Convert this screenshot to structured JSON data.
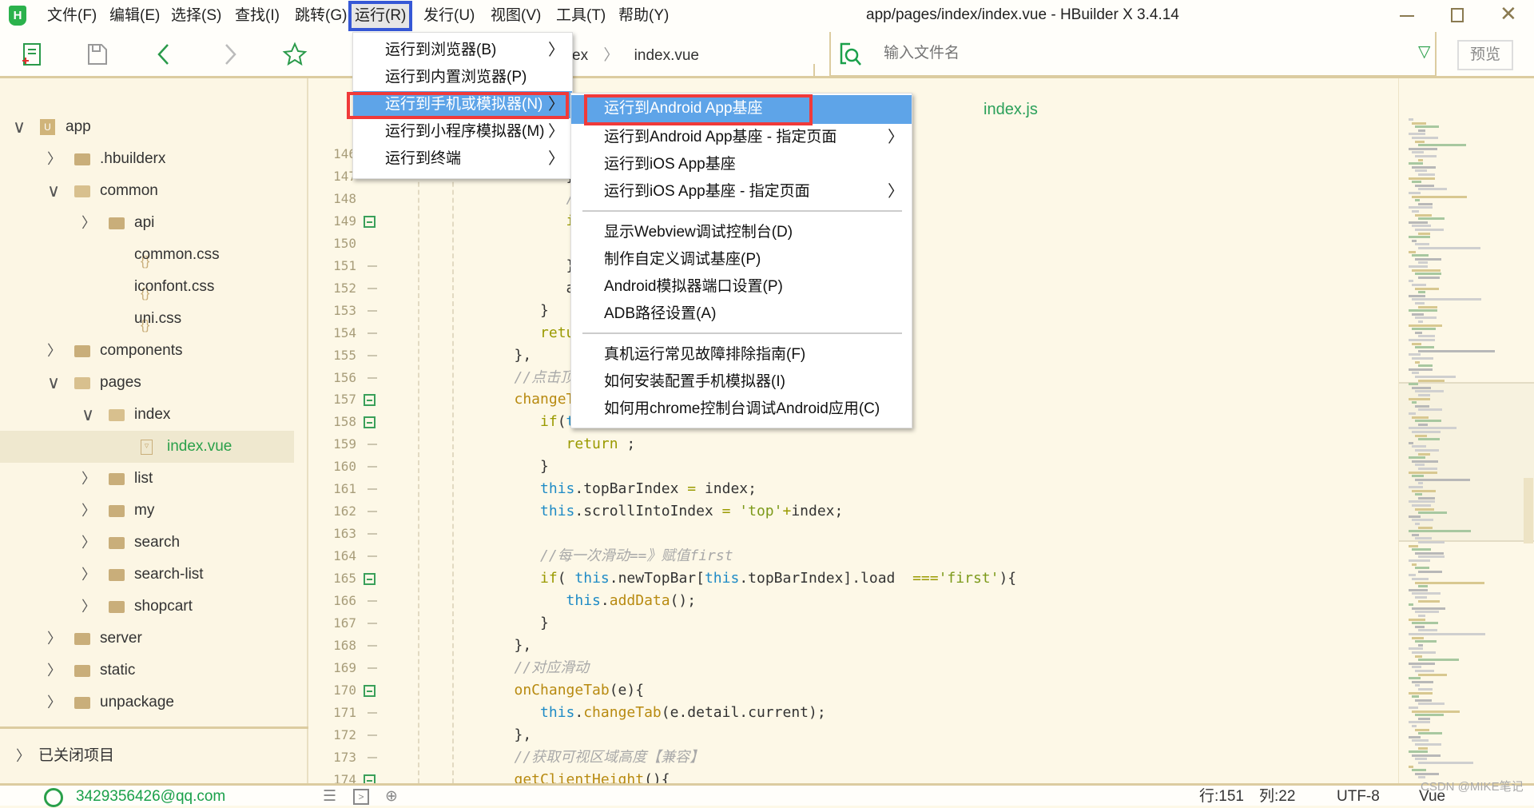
{
  "window": {
    "title": "app/pages/index/index.vue - HBuilder X 3.4.14",
    "logo": "H"
  },
  "menubar": [
    "文件(F)",
    "编辑(E)",
    "选择(S)",
    "查找(I)",
    "跳转(G)",
    "运行(R)",
    "发行(U)",
    "视图(V)",
    "工具(T)",
    "帮助(Y)"
  ],
  "menubar_active": "运行(R)",
  "toolbar": {
    "icons": [
      "new-file-icon",
      "save-icon",
      "back-icon",
      "forward-icon",
      "star-icon"
    ],
    "breadcrumb": [
      "ex",
      "index.vue"
    ],
    "search_placeholder": "输入文件名",
    "preview": "预览"
  },
  "run_menu": [
    {
      "label": "运行到浏览器(B)",
      "submenu": true
    },
    {
      "label": "运行到内置浏览器(P)",
      "submenu": false
    },
    {
      "label": "运行到手机或模拟器(N)",
      "submenu": true,
      "highlighted": true
    },
    {
      "label": "运行到小程序模拟器(M)",
      "submenu": true
    },
    {
      "label": "运行到终端",
      "submenu": true
    }
  ],
  "device_submenu": [
    [
      {
        "label": "运行到Android App基座",
        "highlighted": true
      },
      {
        "label": "运行到Android App基座 - 指定页面",
        "submenu": true
      },
      {
        "label": "运行到iOS App基座"
      },
      {
        "label": "运行到iOS App基座 - 指定页面",
        "submenu": true
      }
    ],
    [
      {
        "label": "显示Webview调试控制台(D)"
      },
      {
        "label": "制作自定义调试基座(P)"
      },
      {
        "label": "Android模拟器端口设置(P)"
      },
      {
        "label": "ADB路径设置(A)"
      }
    ],
    [
      {
        "label": "真机运行常见故障排除指南(F)"
      },
      {
        "label": "如何安装配置手机模拟器(I)"
      },
      {
        "label": "如何用chrome控制台调试Android应用(C)"
      }
    ]
  ],
  "highlight_color": "#f03a3a",
  "tree": [
    {
      "label": "app",
      "level": 0,
      "type": "project",
      "expanded": true
    },
    {
      "label": ".hbuilderx",
      "level": 1,
      "type": "folder",
      "expanded": false
    },
    {
      "label": "common",
      "level": 1,
      "type": "folder",
      "expanded": true
    },
    {
      "label": "api",
      "level": 2,
      "type": "folder",
      "expanded": false
    },
    {
      "label": "common.css",
      "level": 2,
      "type": "css"
    },
    {
      "label": "iconfont.css",
      "level": 2,
      "type": "css"
    },
    {
      "label": "uni.css",
      "level": 2,
      "type": "css"
    },
    {
      "label": "components",
      "level": 1,
      "type": "folder",
      "expanded": false
    },
    {
      "label": "pages",
      "level": 1,
      "type": "folder",
      "expanded": true
    },
    {
      "label": "index",
      "level": 2,
      "type": "folder",
      "expanded": true
    },
    {
      "label": "index.vue",
      "level": 3,
      "type": "vue",
      "selected": true
    },
    {
      "label": "list",
      "level": 2,
      "type": "folder",
      "expanded": false
    },
    {
      "label": "my",
      "level": 2,
      "type": "folder",
      "expanded": false
    },
    {
      "label": "search",
      "level": 2,
      "type": "folder",
      "expanded": false
    },
    {
      "label": "search-list",
      "level": 2,
      "type": "folder",
      "expanded": false
    },
    {
      "label": "shopcart",
      "level": 2,
      "type": "folder",
      "expanded": false
    },
    {
      "label": "server",
      "level": 1,
      "type": "folder",
      "expanded": false
    },
    {
      "label": "static",
      "level": 1,
      "type": "folder",
      "expanded": false
    },
    {
      "label": "unpackage",
      "level": 1,
      "type": "folder",
      "expanded": false
    }
  ],
  "closed_projects": "已关闭项目",
  "editor": {
    "tab": "index.js",
    "lines": [
      {
        "n": 146,
        "t": []
      },
      {
        "n": 147,
        "t": [
          [
            "pl",
            "         }"
          ]
        ]
      },
      {
        "n": 148,
        "t": [
          [
            "cm",
            "         //"
          ]
        ]
      },
      {
        "n": 149,
        "fold": true,
        "t": [
          [
            "kw",
            "         i"
          ]
        ]
      },
      {
        "n": 150,
        "t": []
      },
      {
        "n": 151,
        "t": [
          [
            "pl",
            "         }"
          ]
        ]
      },
      {
        "n": 152,
        "t": [
          [
            "pl",
            "         a"
          ]
        ]
      },
      {
        "n": 153,
        "t": [
          [
            "pl",
            "      }"
          ]
        ]
      },
      {
        "n": 154,
        "t": [
          [
            "kw",
            "      retur"
          ]
        ]
      },
      {
        "n": 155,
        "t": [
          [
            "pl",
            "   },"
          ]
        ]
      },
      {
        "n": 156,
        "t": [
          [
            "cm",
            "   //点击顶栏"
          ]
        ]
      },
      {
        "n": 157,
        "fold": true,
        "t": [
          [
            "fn",
            "   changeTab"
          ]
        ]
      },
      {
        "n": 158,
        "fold": true,
        "t": [
          [
            "kw",
            "      if"
          ],
          [
            "pl",
            "("
          ],
          [
            "th",
            "thi"
          ]
        ]
      },
      {
        "n": 159,
        "t": [
          [
            "kw",
            "         return"
          ],
          [
            "pl",
            " ;"
          ]
        ]
      },
      {
        "n": 160,
        "t": [
          [
            "pl",
            "      }"
          ]
        ]
      },
      {
        "n": 161,
        "t": [
          [
            "th",
            "      this"
          ],
          [
            "pl",
            ".topBarIndex "
          ],
          [
            "op",
            "="
          ],
          [
            "pl",
            " index;"
          ]
        ]
      },
      {
        "n": 162,
        "t": [
          [
            "th",
            "      this"
          ],
          [
            "pl",
            ".scrollIntoIndex "
          ],
          [
            "op",
            "="
          ],
          [
            "pl",
            " "
          ],
          [
            "st",
            "'top'"
          ],
          [
            "op",
            "+"
          ],
          [
            "pl",
            "index;"
          ]
        ]
      },
      {
        "n": 163,
        "t": []
      },
      {
        "n": 164,
        "t": [
          [
            "cm",
            "      //每一次滑动==》赋值first"
          ]
        ]
      },
      {
        "n": 165,
        "fold": true,
        "t": [
          [
            "kw",
            "      if"
          ],
          [
            "pl",
            "( "
          ],
          [
            "th",
            "this"
          ],
          [
            "pl",
            ".newTopBar["
          ],
          [
            "th",
            "this"
          ],
          [
            "pl",
            ".topBarIndex].load  "
          ],
          [
            "op",
            "==="
          ],
          [
            "st",
            "'first'"
          ],
          [
            "pl",
            "){"
          ]
        ]
      },
      {
        "n": 166,
        "t": [
          [
            "th",
            "         this"
          ],
          [
            "pl",
            "."
          ],
          [
            "fn",
            "addData"
          ],
          [
            "pl",
            "();"
          ]
        ]
      },
      {
        "n": 167,
        "t": [
          [
            "pl",
            "      }"
          ]
        ]
      },
      {
        "n": 168,
        "t": [
          [
            "pl",
            "   },"
          ]
        ]
      },
      {
        "n": 169,
        "t": [
          [
            "cm",
            "   //对应滑动"
          ]
        ]
      },
      {
        "n": 170,
        "fold": true,
        "t": [
          [
            "fn",
            "   onChangeTab"
          ],
          [
            "pl",
            "(e){"
          ]
        ]
      },
      {
        "n": 171,
        "t": [
          [
            "th",
            "      this"
          ],
          [
            "pl",
            "."
          ],
          [
            "fn",
            "changeTab"
          ],
          [
            "pl",
            "(e.detail.current);"
          ]
        ]
      },
      {
        "n": 172,
        "t": [
          [
            "pl",
            "   },"
          ]
        ]
      },
      {
        "n": 173,
        "t": [
          [
            "cm",
            "   //获取可视区域高度【兼容】"
          ]
        ]
      },
      {
        "n": 174,
        "fold": true,
        "t": [
          [
            "fn",
            "   getClientHeight"
          ],
          [
            "pl",
            "(){"
          ]
        ]
      }
    ]
  },
  "statusbar": {
    "account": "3429356426@qq.com",
    "position_line": "行:151",
    "position_col": "列:22",
    "encoding": "UTF-8",
    "language": "Vue",
    "watermark": "CSDN @MIKE笔记"
  }
}
